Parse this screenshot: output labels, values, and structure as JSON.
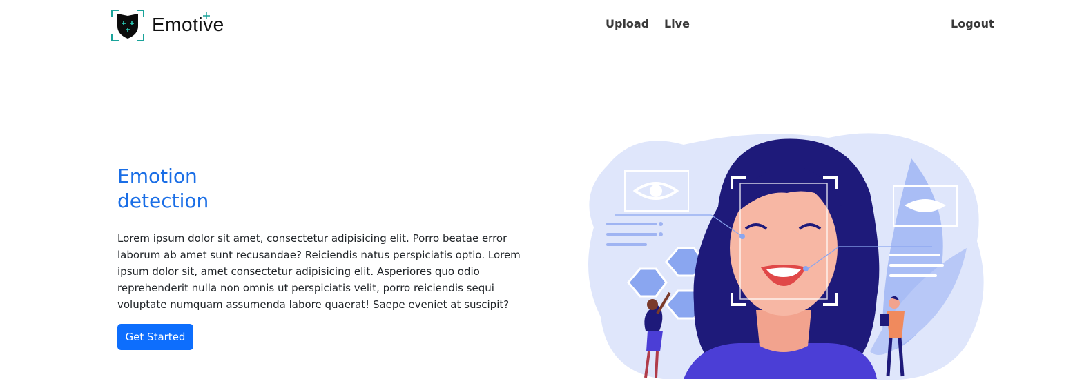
{
  "brand": {
    "name": "Emotive",
    "logo_icon": "shield-face-scan-icon"
  },
  "nav": {
    "upload": "Upload",
    "live": "Live",
    "logout": "Logout"
  },
  "hero": {
    "title_line1": "Emotion",
    "title_line2": "detection",
    "description": "Lorem ipsum dolor sit amet, consectetur adipisicing elit. Porro beatae error laborum ab amet sunt recusandae? Reiciendis natus perspiciatis optio. Lorem ipsum dolor sit, amet consectetur adipisicing elit. Asperiores quo odio reprehenderit nulla non omnis ut perspiciatis velit, porro reiciendis sequi voluptate numquam assumenda labore quaerat! Saepe eveniet at suscipit?",
    "cta_label": "Get Started",
    "illustration": "face-recognition-illustration"
  },
  "colors": {
    "accent": "#0d6efd",
    "title": "#1a6ee6",
    "logo_teal": "#1aa39a"
  }
}
